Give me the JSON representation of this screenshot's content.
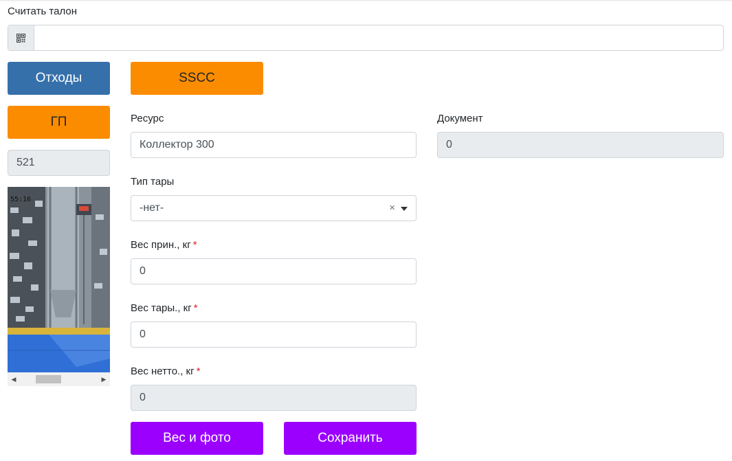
{
  "scan": {
    "label": "Считать талон",
    "value": "",
    "icon": "qr-code-icon"
  },
  "buttons": {
    "waste": "Отходы",
    "sscc": "SSCC",
    "gp": "ГП",
    "weigh_photo": "Вес и фото",
    "save": "Сохранить"
  },
  "counter": {
    "value": "521"
  },
  "camera": {
    "timestamp": "55:16"
  },
  "form": {
    "resource": {
      "label": "Ресурс",
      "value": "Коллектор 300"
    },
    "document": {
      "label": "Документ",
      "value": "0"
    },
    "tare_type": {
      "label": "Тип тары",
      "value": "-нет-",
      "clear": "×"
    },
    "gross_weight": {
      "label": "Вес прин., кг",
      "required": "*",
      "value": "0"
    },
    "tare_weight": {
      "label": "Вес тары., кг",
      "required": "*",
      "value": "0"
    },
    "net_weight": {
      "label": "Вес нетто., кг",
      "required": "*",
      "value": "0"
    }
  },
  "colors": {
    "blue": "#3670ab",
    "orange": "#fb8c00",
    "purple": "#9b00ff",
    "required": "#e02020"
  }
}
